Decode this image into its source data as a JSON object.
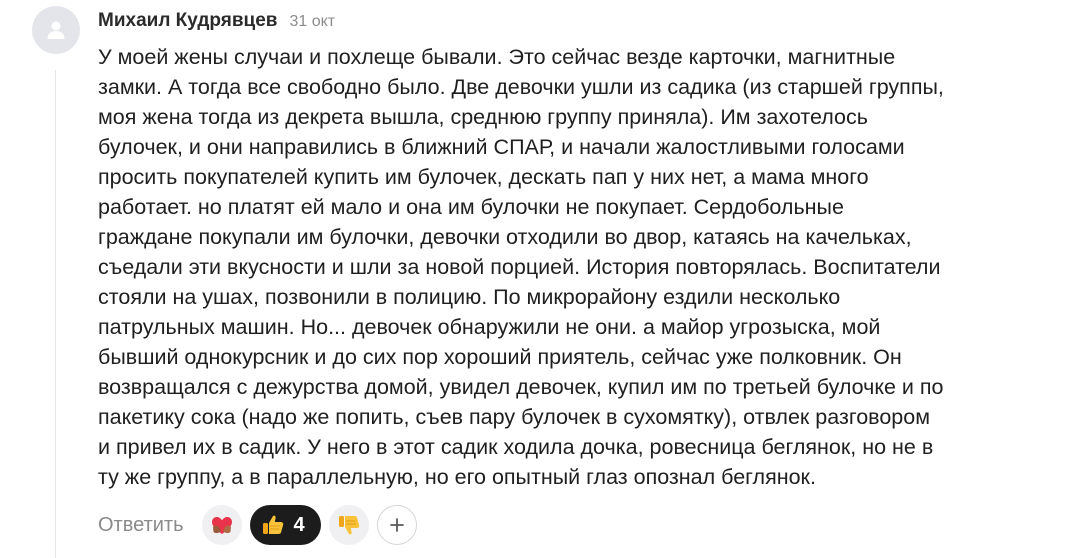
{
  "comment": {
    "author": "Михаил Кудрявцев",
    "date": "31 окт",
    "lines": [
      "У моей жены случаи и похлеще бывали. Это сейчас везде карточки, магнитные",
      "замки. А тогда все свободно было. Две девочки ушли из садика (из старшей группы,",
      "моя жена тогда из декрета вышла, среднюю группу приняла). Им захотелось",
      "булочек, и они направились в ближний СПАР, и начали жалостливыми голосами",
      "просить покупателей купить им булочек, дескать пап у них нет, а мама много",
      "работает. но платят ей мало и она им булочки не покупает. Сердобольные",
      "граждане покупали им булочки, девочки отходили во двор, катаясь на качельках,",
      "съедали эти вкусности и шли за новой порцией. История повторялась. Воспитатели",
      "стояли на ушах, позвонили в полицию. По микрорайону ездили несколько",
      "патрульных машин. Но... девочек обнаружили не они. а майор угрозыска, мой",
      "бывший однокурсник и до сих пор хороший приятель, сейчас уже полковник. Он",
      "возвращался с дежурства домой, увидел девочек, купил им по третьей булочке и по",
      "пакетику сока (надо же попить, съев пару булочек в сухомятку), отвлек разговором",
      "и привел их в садик. У него в этот садик ходила дочка, ровесница беглянок, но не в",
      "ту же группу, а в параллельную, но его опытный глаз опознал беглянок."
    ]
  },
  "actions": {
    "reply_label": "Ответить",
    "reactions": [
      {
        "icon": "heart-hands-emoji-icon",
        "count": null
      },
      {
        "icon": "thumbs-up-emoji-icon",
        "count": "4",
        "active": true
      },
      {
        "icon": "thumbs-down-emoji-icon",
        "count": null
      }
    ],
    "add_reaction_icon": "plus-icon"
  },
  "colors": {
    "avatar_bg": "#e3e5ea",
    "author": "#2b2b2b",
    "date": "#8c8c8c",
    "text": "#1f1f1f",
    "reply": "#8a8a8a",
    "active_pill": "#1c1c1c",
    "inactive_pill": "#f0f0f2"
  }
}
